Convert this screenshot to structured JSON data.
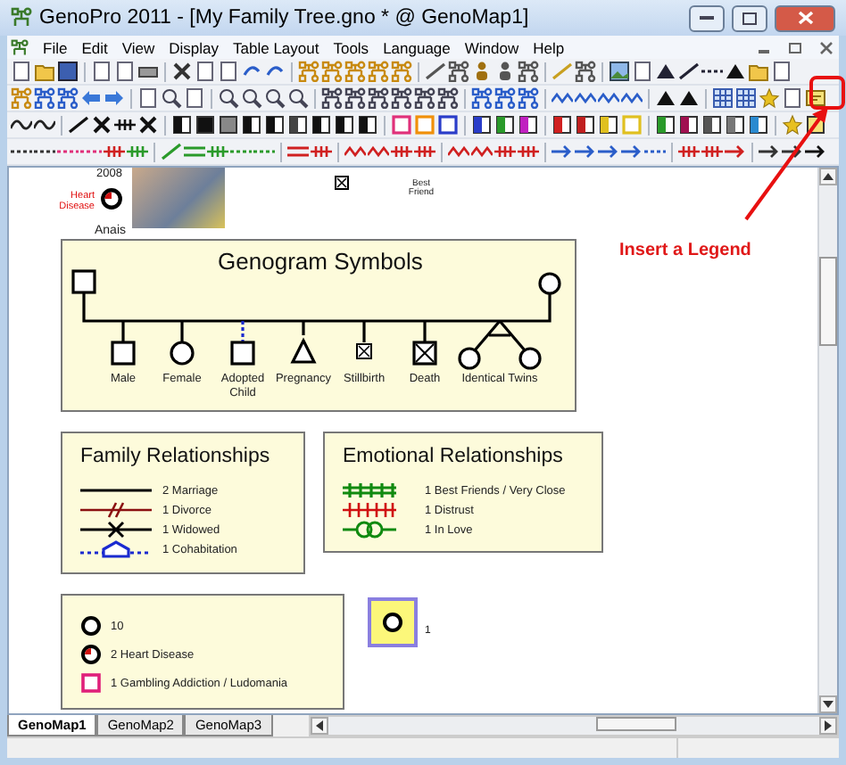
{
  "window": {
    "title": "GenoPro 2011 - [My Family Tree.gno * @ GenoMap1]"
  },
  "menu": [
    "File",
    "Edit",
    "View",
    "Display",
    "Table Layout",
    "Tools",
    "Language",
    "Window",
    "Help"
  ],
  "canvas": {
    "person": {
      "year": "2008",
      "condition": "Heart Disease",
      "name": "Anais"
    },
    "other_label": "Best Friend",
    "callout": "Insert a Legend",
    "symbols_legend": {
      "title": "Genogram Symbols",
      "labels": [
        "Male",
        "Female",
        "Adopted Child",
        "Pregnancy",
        "Stillbirth",
        "Death",
        "Identical Twins"
      ]
    },
    "family_legend": {
      "title": "Family Relationships",
      "items": [
        {
          "kind": "marriage",
          "label": "2 Marriage"
        },
        {
          "kind": "divorce",
          "label": "1 Divorce"
        },
        {
          "kind": "widowed",
          "label": "1 Widowed"
        },
        {
          "kind": "cohabitation",
          "label": "1 Cohabitation"
        }
      ]
    },
    "emotional_legend": {
      "title": "Emotional Relationships",
      "items": [
        {
          "kind": "close",
          "label": "1 Best Friends / Very Close"
        },
        {
          "kind": "distrust",
          "label": "1 Distrust"
        },
        {
          "kind": "love",
          "label": "1 In Love"
        }
      ]
    },
    "conditions_legend": {
      "items": [
        {
          "kind": "circle",
          "label": "10"
        },
        {
          "kind": "heart",
          "label": "2 Heart Disease"
        },
        {
          "kind": "addiction",
          "label": "1 Gambling Addiction / Ludomania"
        }
      ]
    },
    "highlight_node": {
      "label": "1"
    }
  },
  "tabs": [
    {
      "label": "GenoMap1",
      "selected": true
    },
    {
      "label": "GenoMap2",
      "selected": false
    },
    {
      "label": "GenoMap3",
      "selected": false
    }
  ]
}
